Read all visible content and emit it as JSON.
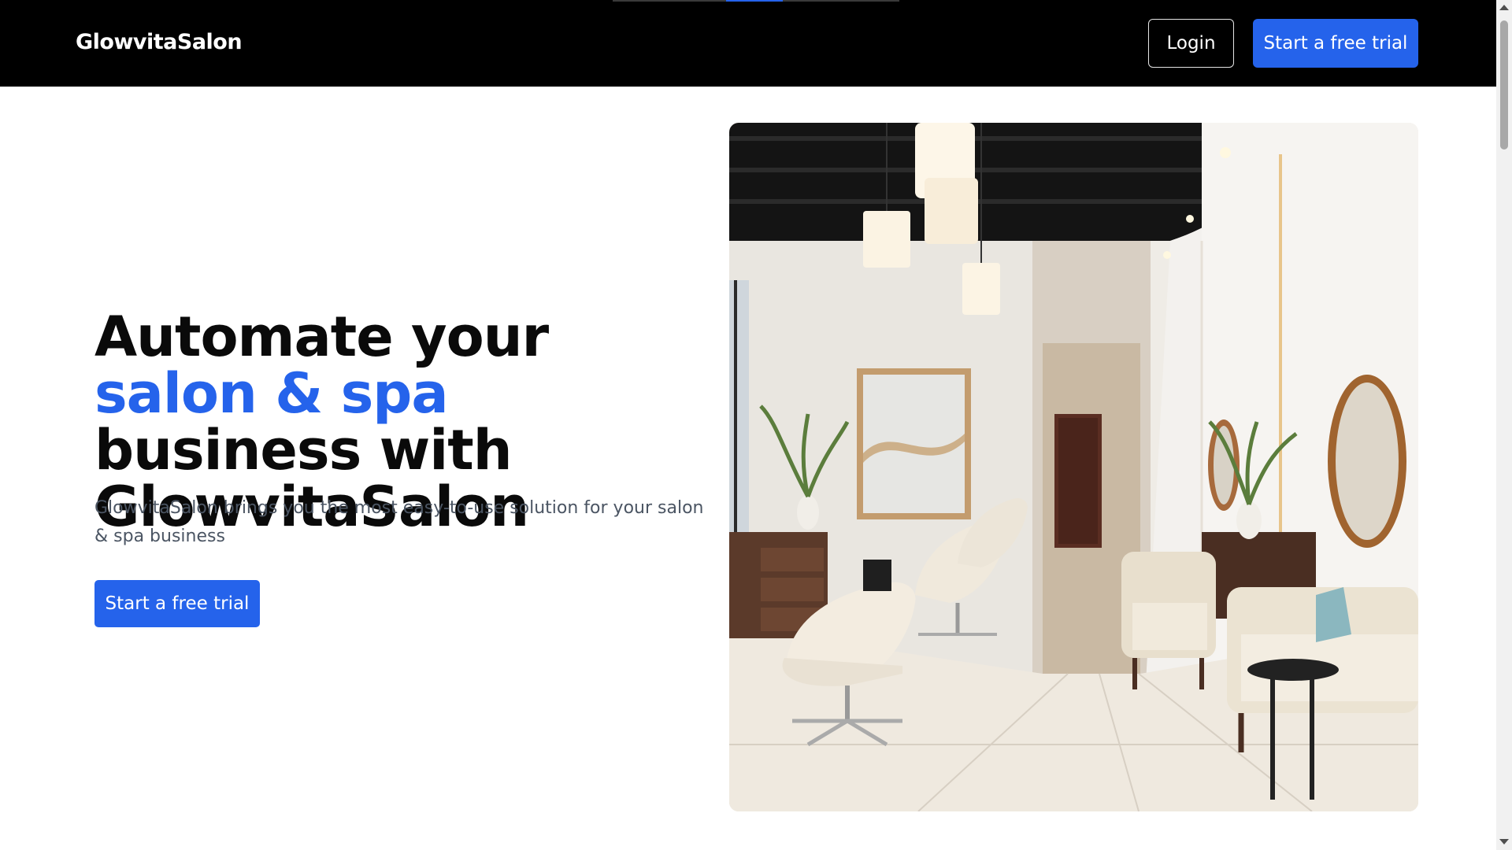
{
  "header": {
    "brand": "GlowvitaSalon",
    "login_label": "Login",
    "trial_label": "Start a free trial"
  },
  "hero": {
    "title_part1": "Automate your ",
    "title_accent": "salon & spa",
    "title_part2": " business with GlowvitaSalon",
    "subtitle": "GlowvitaSalon brings you the most easy-to-use solution for your salon & spa business",
    "cta_label": "Start a free trial",
    "image_alt": "salon-interior-image"
  },
  "colors": {
    "accent": "#2563eb",
    "header_bg": "#000000",
    "text": "#0a0a0a",
    "muted_text": "#4b5563"
  },
  "icons": {
    "scroll_up": "triangle-up-icon",
    "scroll_down": "triangle-down-icon"
  }
}
